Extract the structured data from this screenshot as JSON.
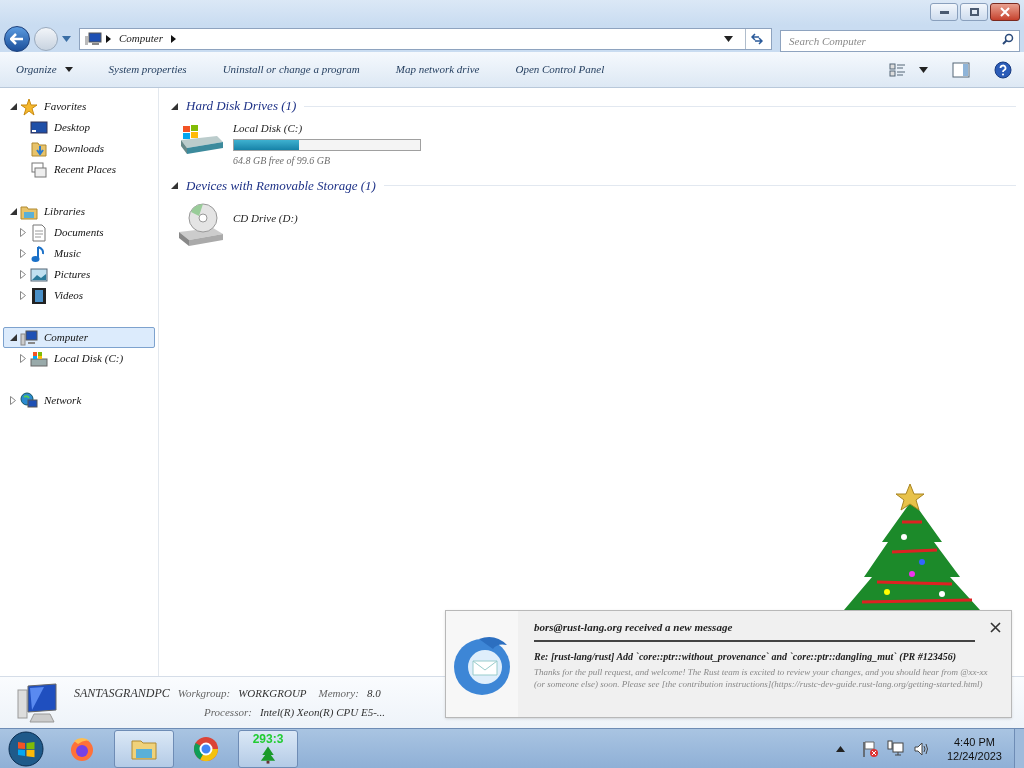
{
  "address_bar": {
    "path": [
      "Computer"
    ]
  },
  "search": {
    "placeholder": "Search Computer"
  },
  "toolbar": {
    "items": [
      {
        "label": "Organize",
        "menu": true
      },
      {
        "label": "System properties",
        "menu": false
      },
      {
        "label": "Uninstall or change a program",
        "menu": false
      },
      {
        "label": "Map network drive",
        "menu": false
      },
      {
        "label": "Open Control Panel",
        "menu": false
      }
    ]
  },
  "sidebar": {
    "items": [
      {
        "label": "Favorites",
        "kind": "star",
        "expanded": true,
        "selected": false,
        "children": [
          {
            "label": "Desktop",
            "kind": "desktop",
            "selected": false
          },
          {
            "label": "Downloads",
            "kind": "downloads",
            "selected": false
          },
          {
            "label": "Recent Places",
            "kind": "recent",
            "selected": false
          }
        ]
      },
      {
        "label": "Libraries",
        "kind": "libraries",
        "expanded": true,
        "selected": false,
        "children": [
          {
            "label": "Documents",
            "kind": "documents",
            "expanded": false,
            "selected": false
          },
          {
            "label": "Music",
            "kind": "music",
            "expanded": false,
            "selected": false
          },
          {
            "label": "Pictures",
            "kind": "pictures",
            "expanded": false,
            "selected": false
          },
          {
            "label": "Videos",
            "kind": "videos",
            "expanded": false,
            "selected": false
          }
        ]
      },
      {
        "label": "Computer",
        "kind": "computer",
        "expanded": true,
        "selected": true,
        "children": [
          {
            "label": "Local Disk (C:)",
            "kind": "disk",
            "expanded": false,
            "selected": false
          }
        ]
      },
      {
        "label": "Network",
        "kind": "network",
        "expanded": false,
        "selected": false
      }
    ]
  },
  "groups": [
    {
      "title": "Hard Disk Drives (1)",
      "items": [
        {
          "kind": "hdd",
          "name": "Local Disk (C:)",
          "level": 0.35,
          "space": "64.8 GB free of 99.6 GB"
        }
      ]
    },
    {
      "title": "Devices with Removable Storage (1)",
      "items": [
        {
          "kind": "cd",
          "name": "CD Drive (D:)"
        }
      ]
    }
  ],
  "details": {
    "name": "SANTASGRANDPC",
    "fields": [
      {
        "label": "Workgroup:",
        "value": "WORKGROUP"
      },
      {
        "label": "Memory:",
        "value": "8.0"
      },
      {
        "label": "Processor:",
        "value": "Intel(R) Xeon(R) CPU E5-..."
      }
    ]
  },
  "notification": {
    "title": "bors@rust-lang.org received a new message",
    "subject": "Re: [rust-lang/rust] Add `core::ptr::without_provenance` and `core::ptr::dangling_mut` (PR #123456)",
    "body": "Thanks for the pull request, and welcome! The Rust team is excited to review your changes, and you should hear from @xx-xx (or someone else) soon. Please see [the contribution instructions](https://rustc-dev-guide.rust-lang.org/getting-started.html)"
  },
  "taskbar": {
    "apps": [
      {
        "kind": "firefox",
        "open": false
      },
      {
        "kind": "explorer",
        "open": true
      },
      {
        "kind": "chrome",
        "open": false
      },
      {
        "kind": "tree",
        "open": true,
        "label": "293:3"
      }
    ],
    "time": "4:40 PM",
    "date": "12/24/2023"
  }
}
